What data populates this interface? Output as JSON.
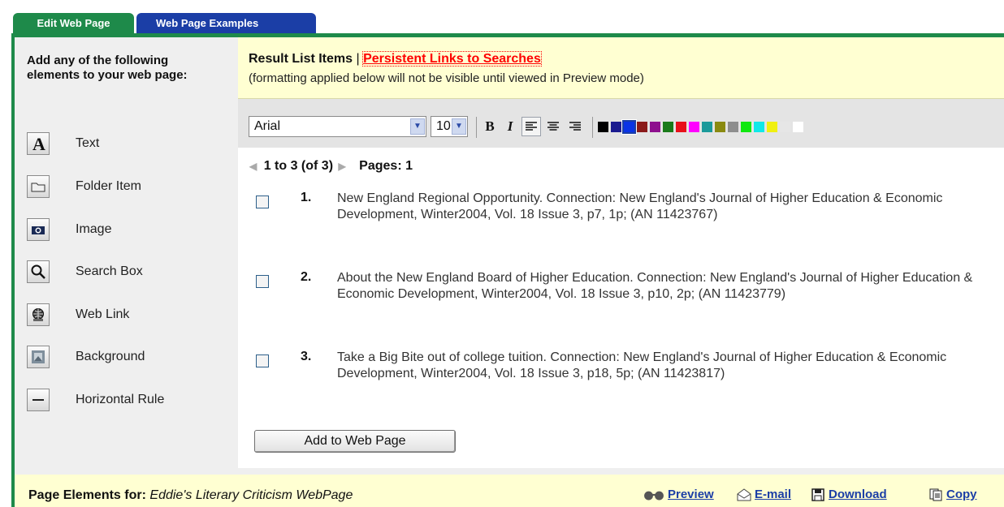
{
  "tabs": [
    {
      "label": "Edit Web Page",
      "active": true
    },
    {
      "label": "Web Page Examples",
      "active": false
    }
  ],
  "sidebar": {
    "intro": "Add any of the following elements to your web page:",
    "items": [
      {
        "label": "Text",
        "icon": "text-icon"
      },
      {
        "label": "Folder Item",
        "icon": "folder-icon"
      },
      {
        "label": "Image",
        "icon": "camera-icon"
      },
      {
        "label": "Search Box",
        "icon": "magnifier-icon"
      },
      {
        "label": "Web Link",
        "icon": "globe-icon"
      },
      {
        "label": "Background",
        "icon": "background-icon"
      },
      {
        "label": "Horizontal Rule",
        "icon": "horizontal-rule-icon"
      }
    ]
  },
  "header": {
    "title": "Result List Items",
    "separator": "|",
    "link": "Persistent Links to Searches",
    "subtitle": "(formatting applied below will not be visible until viewed in Preview mode)"
  },
  "toolbar": {
    "font": "Arial",
    "size": "10",
    "bold": "B",
    "italic": "I",
    "swatches": [
      "#000000",
      "#1b1b8f",
      "#0a33e6",
      "#8b1a1a",
      "#8e108e",
      "#1a7a1a",
      "#e8101a",
      "#ff00ff",
      "#1a9a9a",
      "#8a8a10",
      "#8e8e8e",
      "#10e810",
      "#10e8e8",
      "#f0f010",
      "#e6e6e6",
      "#ffffff"
    ]
  },
  "results": {
    "pager_range": "1 to 3 (of 3)",
    "pages": "Pages: 1",
    "items": [
      {
        "num": "1.",
        "text": "New England Regional Opportunity. Connection: New England's Journal of Higher Education & Economic Development, Winter2004, Vol. 18 Issue 3, p7, 1p; (AN 11423767)"
      },
      {
        "num": "2.",
        "text": "About the New England Board of Higher Education. Connection: New England's Journal of Higher Education & Economic Development, Winter2004, Vol. 18 Issue 3, p10, 2p; (AN 11423779)"
      },
      {
        "num": "3.",
        "text": "Take a Big Bite out of college tuition. Connection: New England's Journal of Higher Education & Economic Development, Winter2004, Vol. 18 Issue 3, p18, 5p; (AN 11423817)"
      }
    ],
    "add_button": "Add to Web Page"
  },
  "footer": {
    "label": "Page Elements for:",
    "page_name": "Eddie's Literary Criticism WebPage",
    "links": {
      "preview": "Preview",
      "email": "E-mail",
      "download": "Download",
      "copy": "Copy"
    }
  }
}
